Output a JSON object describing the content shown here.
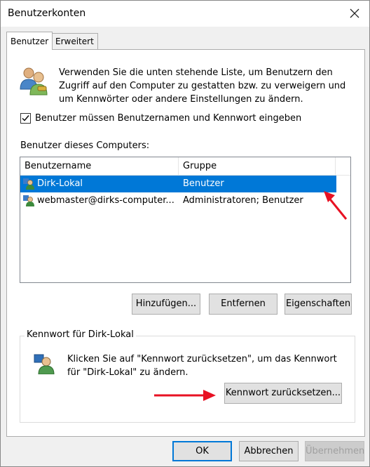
{
  "window": {
    "title": "Benutzerkonten",
    "close_icon": "close-icon"
  },
  "tabs": [
    {
      "label": "Benutzer",
      "active": true
    },
    {
      "label": "Erweitert",
      "active": false
    }
  ],
  "intro_text": "Verwenden Sie die unten stehende Liste, um Benutzern den Zugriff auf den Computer zu gestatten bzw. zu verweigern und um Kennwörter oder andere Einstellungen zu ändern.",
  "require_login": {
    "label": "Benutzer müssen Benutzernamen und Kennwort eingeben",
    "checked": true
  },
  "users_section_label": "Benutzer dieses Computers:",
  "user_list": {
    "columns": [
      "Benutzername",
      "Gruppe"
    ],
    "rows": [
      {
        "name": "Dirk-Lokal",
        "group": "Benutzer",
        "selected": true
      },
      {
        "name": "webmaster@dirks-computer...",
        "group": "Administratoren; Benutzer",
        "selected": false
      }
    ]
  },
  "list_buttons": {
    "add": "Hinzufügen...",
    "remove": "Entfernen",
    "properties": "Eigenschaften"
  },
  "password_group": {
    "title": "Kennwort für Dirk-Lokal",
    "text": "Klicken Sie auf \"Kennwort zurücksetzen\", um das Kennwort für \"Dirk-Lokal\" zu ändern.",
    "reset_button": "Kennwort zurücksetzen..."
  },
  "dialog_buttons": {
    "ok": "OK",
    "cancel": "Abbrechen",
    "apply": "Übernehmen"
  },
  "colors": {
    "selection": "#0078d7",
    "annotation_arrow": "#e81123"
  }
}
